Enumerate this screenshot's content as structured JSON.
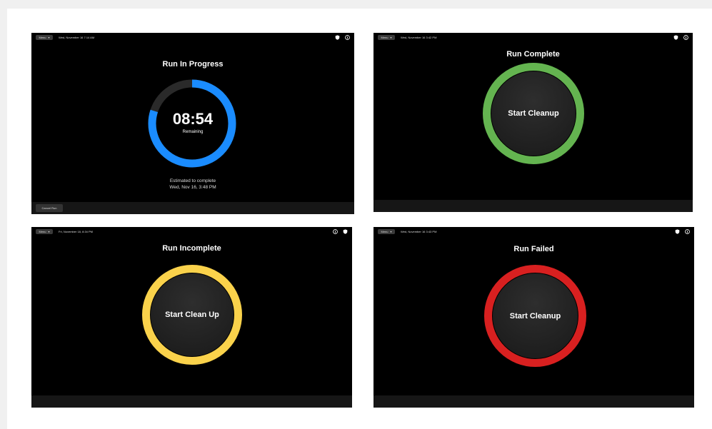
{
  "screens": [
    {
      "menu_label": "Menu",
      "datetime": "Wed, November 16 7:14 AM",
      "title": "Run In Progress",
      "timer": "08:54",
      "timer_sub": "Remaining",
      "estimate_line1": "Estimated to complete",
      "estimate_line2": "Wed, Nov 16, 3:48 PM",
      "cancel_label": "Cancel Run",
      "progress_fraction": 0.8,
      "ring_color": "#1a8cff",
      "icons": [
        "shield-icon",
        "info-icon"
      ]
    },
    {
      "menu_label": "Menu",
      "datetime": "Wed, November 16 3:42 PM",
      "title": "Run Complete",
      "button_label": "Start Cleanup",
      "ring_color": "#64b450",
      "icons": [
        "shield-icon",
        "info-icon"
      ]
    },
    {
      "menu_label": "Menu",
      "datetime": "Fri, November 18, 8:34 PM",
      "title": "Run Incomplete",
      "button_label": "Start Clean Up",
      "ring_color": "#fad24b",
      "icons": [
        "info-icon",
        "shield-icon"
      ]
    },
    {
      "menu_label": "Menu",
      "datetime": "Wed, November 16 3:43 PM",
      "title": "Run Failed",
      "button_label": "Start Cleanup",
      "ring_color": "#d82020",
      "icons": [
        "shield-icon",
        "info-icon"
      ]
    }
  ]
}
